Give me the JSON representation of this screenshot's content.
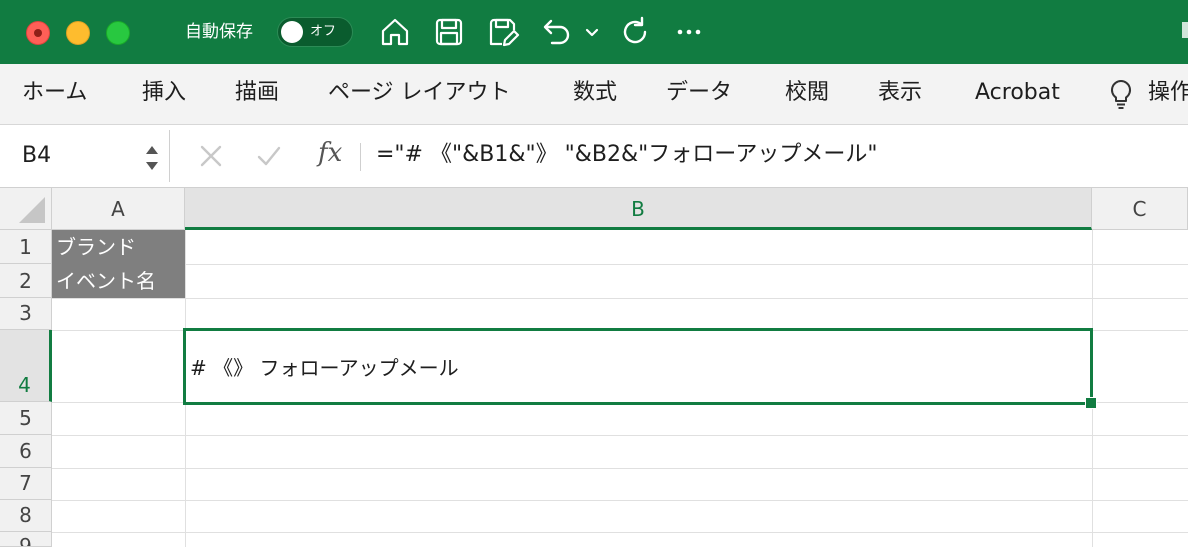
{
  "titlebar": {
    "autosave_label": "自動保存",
    "autosave_state": "オフ",
    "icons": [
      "home-icon",
      "save-icon",
      "save-edit-icon",
      "undo-icon",
      "chevron-down-icon",
      "redo-icon",
      "more-icon"
    ]
  },
  "ribbon": {
    "tabs": [
      "ホーム",
      "挿入",
      "描画",
      "ページ レイアウト",
      "数式",
      "データ",
      "校閲",
      "表示",
      "Acrobat",
      "操作"
    ]
  },
  "formula_bar": {
    "name_box": "B4",
    "fx": "fx",
    "formula": "=\"# 《\"&B1&\"》 \"&B2&\"フォローアップメール\""
  },
  "grid": {
    "columns": [
      "A",
      "B",
      "C"
    ],
    "rows": [
      "1",
      "2",
      "3",
      "4",
      "5",
      "6",
      "7",
      "8",
      "9"
    ],
    "cells": {
      "A1": "ブランド",
      "A2": "イベント名",
      "B4": "# 《》 フォローアップメール"
    }
  },
  "colors": {
    "accent": "#117c41",
    "header_cell_fill": "#7f7f7f"
  }
}
